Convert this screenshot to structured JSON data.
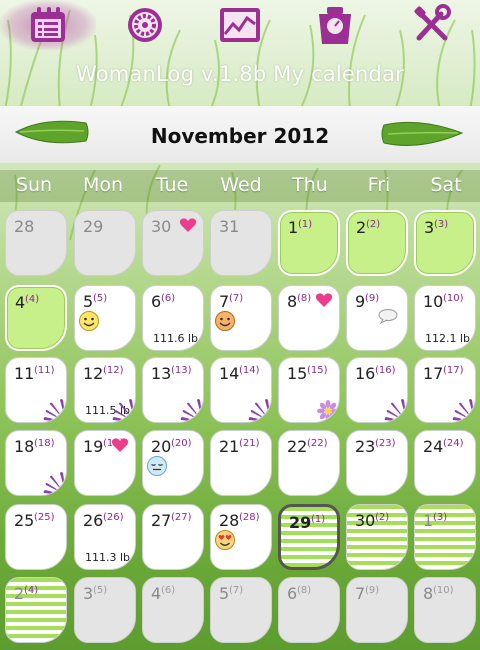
{
  "app": {
    "title": "WomanLog  v.1.8b  My calendar"
  },
  "toolbar": [
    {
      "name": "calendar-icon",
      "selected": true
    },
    {
      "name": "cycle-wheel-icon",
      "selected": false
    },
    {
      "name": "chart-icon",
      "selected": false
    },
    {
      "name": "weight-scale-icon",
      "selected": false
    },
    {
      "name": "settings-tools-icon",
      "selected": false
    }
  ],
  "nav": {
    "month_label": "November 2012",
    "prev": "previous-month",
    "next": "next-month"
  },
  "weekdays": [
    "Sun",
    "Mon",
    "Tue",
    "Wed",
    "Thu",
    "Fri",
    "Sat"
  ],
  "colors": {
    "period": "#c7ef8a",
    "fertile": "#a6dd5a",
    "cycle_number": "#8b2b8b",
    "other_month": "#e4e4e4"
  },
  "weeks": [
    [
      {
        "day": "28",
        "cycle": "",
        "type": "other"
      },
      {
        "day": "29",
        "cycle": "",
        "type": "other"
      },
      {
        "day": "30",
        "cycle": "",
        "type": "other",
        "icons": [
          "heart"
        ]
      },
      {
        "day": "31",
        "cycle": "",
        "type": "other"
      },
      {
        "day": "1",
        "cycle": "(1)",
        "type": "period"
      },
      {
        "day": "2",
        "cycle": "(2)",
        "type": "period"
      },
      {
        "day": "3",
        "cycle": "(3)",
        "type": "period"
      }
    ],
    [
      {
        "day": "4",
        "cycle": "(4)",
        "type": "period"
      },
      {
        "day": "5",
        "cycle": "(5)",
        "type": "normal",
        "icons": [
          "smile"
        ]
      },
      {
        "day": "6",
        "cycle": "(6)",
        "type": "normal",
        "weight": "111.6 lb"
      },
      {
        "day": "7",
        "cycle": "(7)",
        "type": "normal",
        "icons": [
          "smile-orange"
        ]
      },
      {
        "day": "8",
        "cycle": "(8)",
        "type": "normal",
        "icons": [
          "heart"
        ]
      },
      {
        "day": "9",
        "cycle": "(9)",
        "type": "normal",
        "icons": [
          "note"
        ]
      },
      {
        "day": "10",
        "cycle": "(10)",
        "type": "normal",
        "weight": "112.1 lb"
      }
    ],
    [
      {
        "day": "11",
        "cycle": "(11)",
        "type": "normal",
        "icons": [
          "flower"
        ]
      },
      {
        "day": "12",
        "cycle": "(12)",
        "type": "normal",
        "weight": "111.5 lb",
        "icons": [
          "flower"
        ]
      },
      {
        "day": "13",
        "cycle": "(13)",
        "type": "normal",
        "icons": [
          "flower"
        ]
      },
      {
        "day": "14",
        "cycle": "(14)",
        "type": "normal",
        "icons": [
          "flower"
        ]
      },
      {
        "day": "15",
        "cycle": "(15)",
        "type": "normal",
        "icons": [
          "daisy"
        ]
      },
      {
        "day": "16",
        "cycle": "(16)",
        "type": "normal",
        "icons": [
          "flower"
        ]
      },
      {
        "day": "17",
        "cycle": "(17)",
        "type": "normal",
        "icons": [
          "flower"
        ]
      }
    ],
    [
      {
        "day": "18",
        "cycle": "(18)",
        "type": "normal",
        "icons": [
          "flower"
        ]
      },
      {
        "day": "19",
        "cycle": "(19)",
        "type": "normal",
        "icons": [
          "heart"
        ]
      },
      {
        "day": "20",
        "cycle": "(20)",
        "type": "normal",
        "icons": [
          "sleepy"
        ]
      },
      {
        "day": "21",
        "cycle": "(21)",
        "type": "normal"
      },
      {
        "day": "22",
        "cycle": "(22)",
        "type": "normal"
      },
      {
        "day": "23",
        "cycle": "(23)",
        "type": "normal"
      },
      {
        "day": "24",
        "cycle": "(24)",
        "type": "normal"
      }
    ],
    [
      {
        "day": "25",
        "cycle": "(25)",
        "type": "normal"
      },
      {
        "day": "26",
        "cycle": "(26)",
        "type": "normal",
        "weight": "111.3 lb"
      },
      {
        "day": "27",
        "cycle": "(27)",
        "type": "normal"
      },
      {
        "day": "28",
        "cycle": "(28)",
        "type": "normal",
        "icons": [
          "love"
        ]
      },
      {
        "day": "29",
        "cycle": "(1)",
        "type": "fertile",
        "today": true
      },
      {
        "day": "30",
        "cycle": "(2)",
        "type": "fertile"
      },
      {
        "day": "1",
        "cycle": "(3)",
        "type": "fertile-other"
      }
    ],
    [
      {
        "day": "2",
        "cycle": "(4)",
        "type": "fertile-other"
      },
      {
        "day": "3",
        "cycle": "(5)",
        "type": "other"
      },
      {
        "day": "4",
        "cycle": "(6)",
        "type": "other"
      },
      {
        "day": "5",
        "cycle": "(7)",
        "type": "other"
      },
      {
        "day": "6",
        "cycle": "(8)",
        "type": "other"
      },
      {
        "day": "7",
        "cycle": "(9)",
        "type": "other"
      },
      {
        "day": "8",
        "cycle": "(10)",
        "type": "other"
      }
    ]
  ]
}
